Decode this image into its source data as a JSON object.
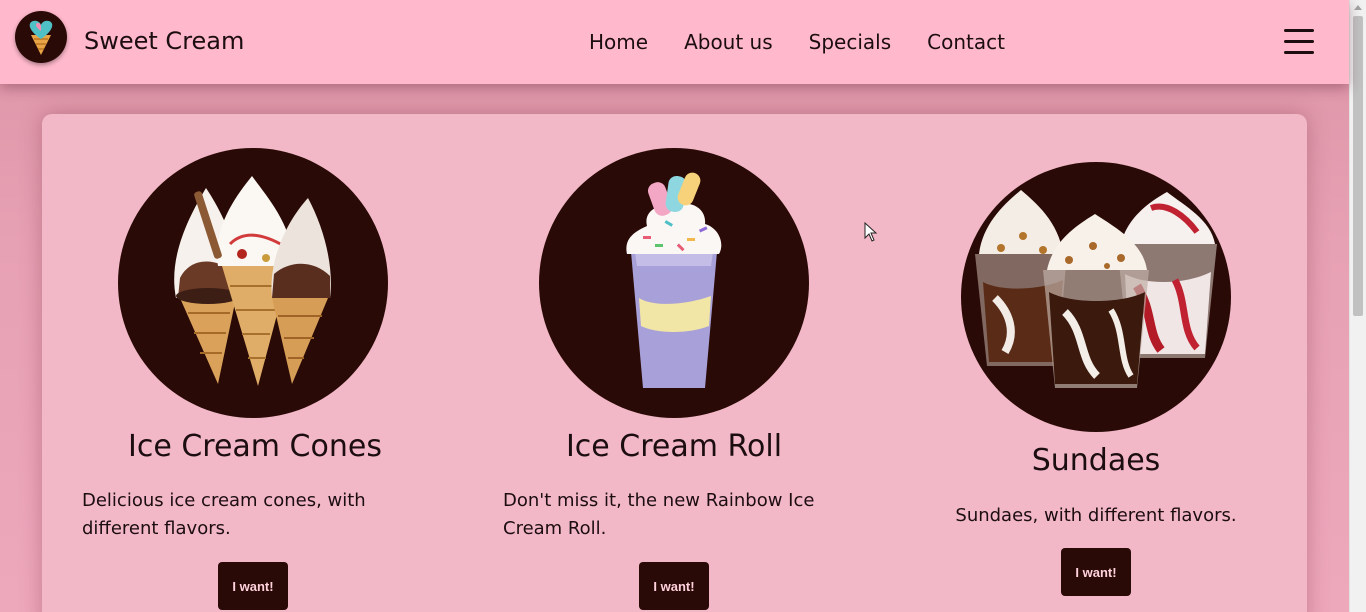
{
  "header": {
    "brand": "Sweet Cream",
    "logo_icon": "ice-cream-heart-logo",
    "nav": [
      {
        "label": "Home"
      },
      {
        "label": "About us"
      },
      {
        "label": "Specials"
      },
      {
        "label": "Contact"
      }
    ],
    "menu_icon": "hamburger-icon"
  },
  "products": [
    {
      "title": "Ice Cream Cones",
      "description": "Delicious ice cream cones, with different flavors.",
      "button": "I want!"
    },
    {
      "title": "Ice Cream Roll",
      "description": "Don't miss it, the new Rainbow Ice Cream Roll.",
      "button": "I want!"
    },
    {
      "title": "Sundaes",
      "description": "Sundaes, with different flavors.",
      "button": "I want!"
    }
  ],
  "colors": {
    "header_bg": "#ffb8cc",
    "panel_bg": "#f3b8c8",
    "accent_dark": "#2a0a06",
    "text": "#1c0d10",
    "button_text": "#ffd1dd"
  }
}
